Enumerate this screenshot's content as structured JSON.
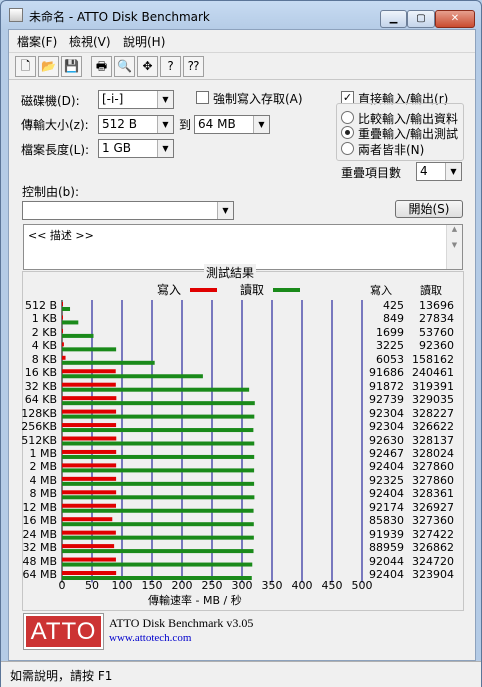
{
  "window": {
    "title": "未命名 - ATTO Disk Benchmark",
    "min_label": "▁",
    "max_label": "▢",
    "close_label": "✕"
  },
  "menu": [
    "檔案(F)",
    "檢視(V)",
    "說明(H)"
  ],
  "toolbar": {
    "buttons": [
      {
        "icon": "new-document-icon",
        "glyph": "🗋"
      },
      {
        "icon": "open-folder-icon",
        "glyph": "📂"
      },
      {
        "icon": "save-icon",
        "glyph": "💾"
      },
      {
        "icon": "print-icon",
        "glyph": "🖶"
      },
      {
        "icon": "print-preview-icon",
        "glyph": "🔍"
      },
      {
        "icon": "move-icon",
        "glyph": "✥"
      },
      {
        "icon": "about-icon",
        "glyph": "?"
      },
      {
        "icon": "context-help-icon",
        "glyph": "⁇"
      }
    ]
  },
  "settings": {
    "drive_label": "磁碟機(D):",
    "drive_value": "[-i-]",
    "transfer_label": "傳輸大小(z):",
    "transfer_from": "512 B",
    "to_label": "到",
    "transfer_to": "64 MB",
    "file_length_label": "檔案長度(L):",
    "file_length_value": "1 GB",
    "force_write_label": "強制寫入存取(A)",
    "force_write_checked": false,
    "direct_io_label": "直接輸入/輸出(r)",
    "direct_io_checked": true,
    "radio_options": [
      "比較輸入/輸出資料",
      "重疊輸入/輸出測試",
      "兩者皆非(N)"
    ],
    "radio_selected": 1,
    "queue_label": "重疊項目數",
    "queue_value": "4",
    "controlled_by_label": "控制由(b):",
    "controlled_by_value": "",
    "start_button": "開始(S)",
    "description": "<< 描述 >>"
  },
  "results": {
    "title": "測試結果",
    "legend_write": "寫入",
    "legend_read": "讀取",
    "col_write": "寫入",
    "col_read": "讀取",
    "xlabel": "傳輸速率 - MB / 秒",
    "colors": {
      "write": "#e00000",
      "read": "#1a8a1a",
      "grid": "#00008b"
    }
  },
  "chart_data": {
    "type": "bar",
    "orientation": "horizontal",
    "categories": [
      "512 B",
      "1 KB",
      "2 KB",
      "4 KB",
      "8 KB",
      "16 KB",
      "32 KB",
      "64 KB",
      "128KB",
      "256KB",
      "512KB",
      "1 MB",
      "2 MB",
      "4 MB",
      "8 MB",
      "12 MB",
      "16 MB",
      "24 MB",
      "32 MB",
      "48 MB",
      "64 MB"
    ],
    "series": [
      {
        "name": "寫入",
        "unit": "KB/s",
        "values": [
          425,
          849,
          1699,
          3225,
          6053,
          91686,
          91872,
          92739,
          92304,
          92304,
          92630,
          92467,
          92404,
          92325,
          92404,
          92174,
          85830,
          91939,
          88959,
          92044,
          92404
        ]
      },
      {
        "name": "讀取",
        "unit": "KB/s",
        "values": [
          13696,
          27834,
          53760,
          92360,
          158162,
          240461,
          319391,
          329035,
          328227,
          326622,
          328137,
          328024,
          327860,
          327860,
          328361,
          326927,
          327360,
          327422,
          326862,
          324720,
          323904
        ]
      }
    ],
    "xlabel": "傳輸速率 - MB / 秒",
    "x_ticks": [
      "0",
      "50",
      "100",
      "150",
      "200",
      "250",
      "300",
      "350",
      "400",
      "450",
      "500"
    ],
    "xlim": [
      0,
      500
    ],
    "grid": true
  },
  "footer": {
    "logo": "ATTO",
    "product": "ATTO Disk Benchmark v3.05",
    "url": "www.attotech.com"
  },
  "status": "如需說明，請按 F1"
}
